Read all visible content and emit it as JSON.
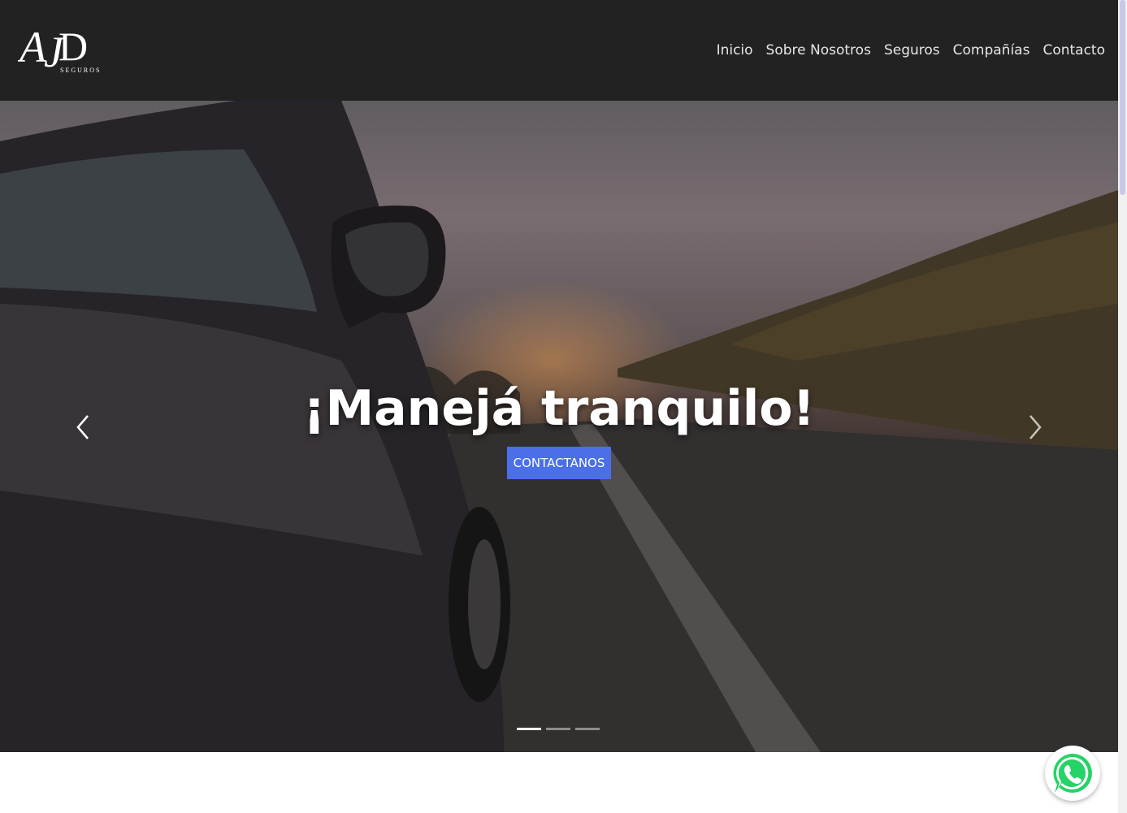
{
  "header": {
    "logo": {
      "monogram": "AJD",
      "tagline": "SEGUROS"
    },
    "nav": [
      {
        "label": "Inicio"
      },
      {
        "label": "Sobre Nosotros"
      },
      {
        "label": "Seguros"
      },
      {
        "label": "Compañías"
      },
      {
        "label": "Contacto"
      }
    ]
  },
  "hero": {
    "title": "¡Manejá tranquilo!",
    "cta_label": "CONTACTANOS",
    "slides_total": 3,
    "active_slide": 1,
    "prev_icon": "chevron-left-icon",
    "next_icon": "chevron-right-icon"
  },
  "floating": {
    "whatsapp_icon": "whatsapp-icon"
  },
  "colors": {
    "navbar_bg": "#222222",
    "nav_text": "#e6e6e6",
    "cta_bg": "#4a6fe8",
    "whatsapp_green": "#25d366"
  }
}
